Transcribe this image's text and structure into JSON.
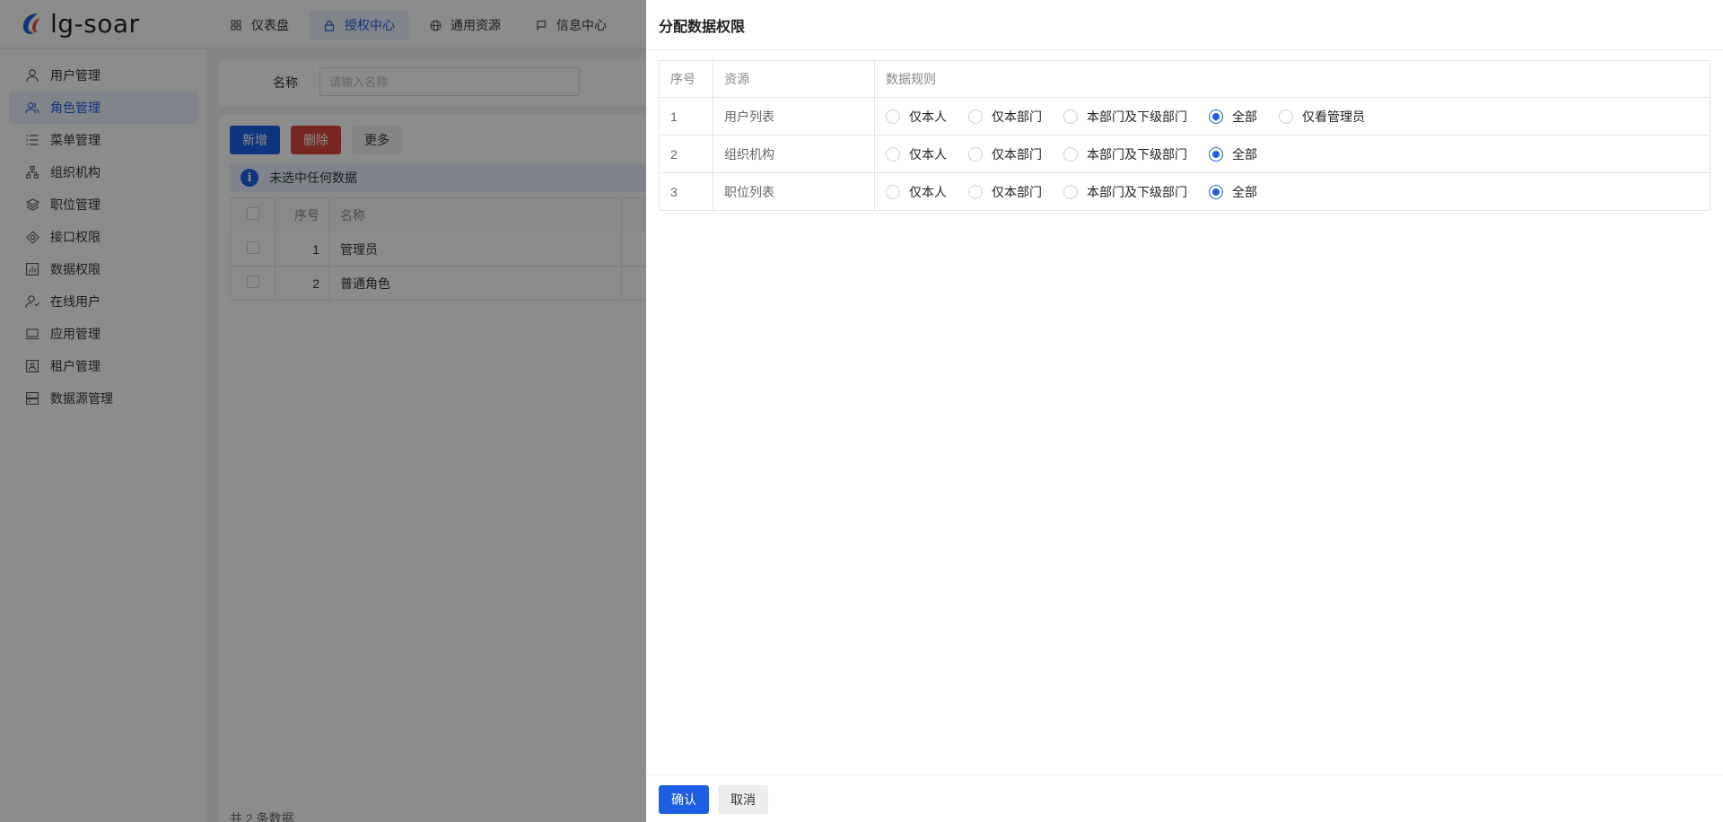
{
  "app": {
    "logo_text": "lg-soar",
    "top_nav": [
      {
        "label": "仪表盘",
        "icon": "dashboard-icon"
      },
      {
        "label": "授权中心",
        "icon": "lock-icon",
        "active": true
      },
      {
        "label": "通用资源",
        "icon": "globe-icon"
      },
      {
        "label": "信息中心",
        "icon": "message-icon"
      }
    ],
    "sidebar": [
      {
        "label": "用户管理",
        "icon": "user-icon"
      },
      {
        "label": "角色管理",
        "icon": "users-icon",
        "active": true
      },
      {
        "label": "菜单管理",
        "icon": "menu-list-icon"
      },
      {
        "label": "组织机构",
        "icon": "org-tree-icon"
      },
      {
        "label": "职位管理",
        "icon": "layers-icon"
      },
      {
        "label": "接口权限",
        "icon": "api-icon"
      },
      {
        "label": "数据权限",
        "icon": "bar-chart-icon"
      },
      {
        "label": "在线用户",
        "icon": "online-user-icon"
      },
      {
        "label": "应用管理",
        "icon": "laptop-icon"
      },
      {
        "label": "租户管理",
        "icon": "tenant-icon"
      },
      {
        "label": "数据源管理",
        "icon": "database-icon"
      }
    ]
  },
  "search": {
    "name_label": "名称",
    "name_placeholder": "请输入名称"
  },
  "toolbar": {
    "add_label": "新增",
    "delete_label": "删除",
    "more_label": "更多"
  },
  "info_text": "未选中任何数据",
  "list_table": {
    "headers": [
      "序号",
      "名称"
    ],
    "rows": [
      {
        "index": "1",
        "name": "管理员"
      },
      {
        "index": "2",
        "name": "普通角色"
      }
    ]
  },
  "total_text": "共 2 条数据",
  "drawer": {
    "title": "分配数据权限",
    "headers": {
      "index": "序号",
      "resource": "资源",
      "rule": "数据规则"
    },
    "rows": [
      {
        "index": "1",
        "resource": "用户列表",
        "options": [
          "仅本人",
          "仅本部门",
          "本部门及下级部门",
          "全部",
          "仅看管理员"
        ],
        "selected": 3
      },
      {
        "index": "2",
        "resource": "组织机构",
        "options": [
          "仅本人",
          "仅本部门",
          "本部门及下级部门",
          "全部"
        ],
        "selected": 3
      },
      {
        "index": "3",
        "resource": "职位列表",
        "options": [
          "仅本人",
          "仅本部门",
          "本部门及下级部门",
          "全部"
        ],
        "selected": 3
      }
    ],
    "confirm_label": "确认",
    "cancel_label": "取消"
  },
  "colors": {
    "primary": "#1d5fe3",
    "danger": "#d9453f",
    "active_bg": "#eaf0fd"
  }
}
